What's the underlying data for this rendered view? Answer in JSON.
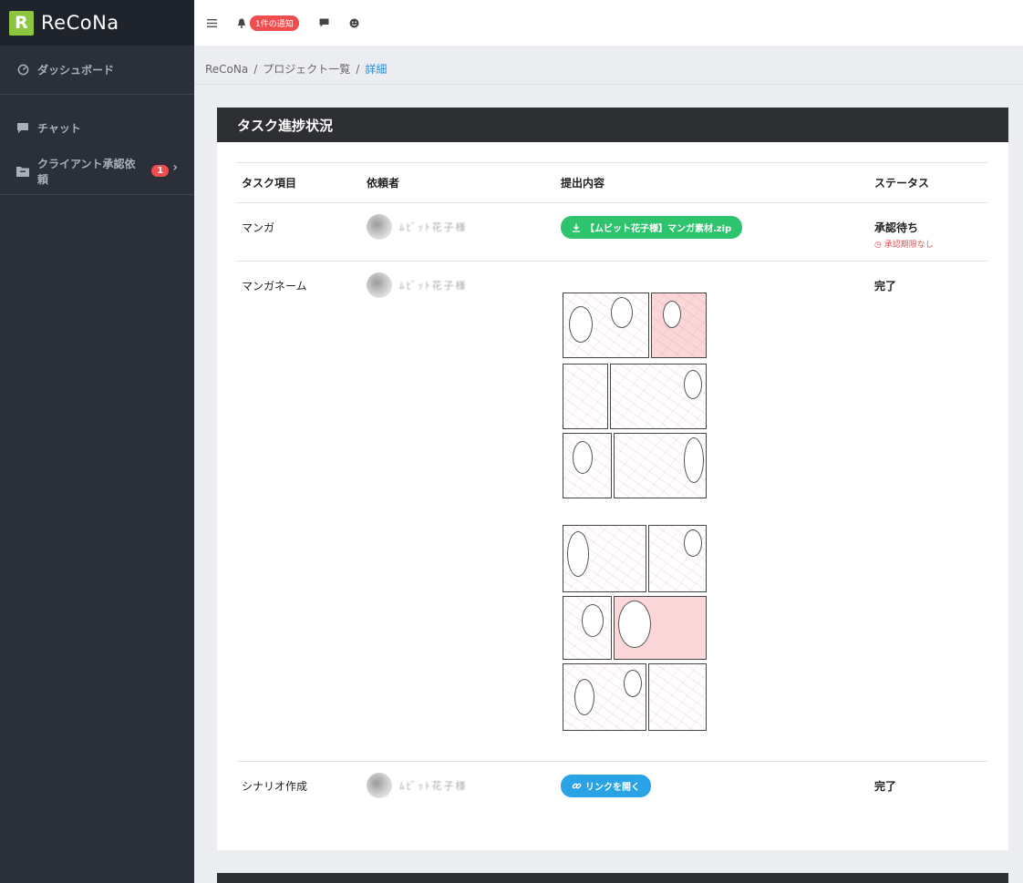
{
  "brand": {
    "mark": "R",
    "name": "ReCoNa"
  },
  "sidebar": {
    "items": [
      {
        "label": "ダッシュボード"
      },
      {
        "label": "チャット"
      },
      {
        "label": "クライアント承認依頼",
        "badge": "1"
      }
    ]
  },
  "topbar": {
    "notification_label": "1件の通知"
  },
  "breadcrumb": {
    "root": "ReCoNa",
    "middle": "プロジェクト一覧",
    "current": "詳細"
  },
  "card": {
    "title": "タスク進捗状況",
    "columns": [
      "タスク項目",
      "依頼者",
      "提出内容",
      "ステータス"
    ],
    "rows": [
      {
        "task": "マンガ",
        "requester": "ﾑﾋﾞｯﾄ花子様",
        "submission": "【ムビット花子様】マンガ素材.zip",
        "status": "承認待ち",
        "status_note": "承認期限なし"
      },
      {
        "task": "マンガネーム",
        "requester": "ﾑﾋﾞｯﾄ花子様",
        "submission": "",
        "status": "完了"
      },
      {
        "task": "シナリオ作成",
        "requester": "ﾑﾋﾞｯﾄ花子様",
        "submission": "リンクを開く",
        "status": "完了"
      }
    ]
  },
  "colors": {
    "sidebar_bg": "#2b2f3a",
    "accent_green": "#2ec46d",
    "accent_blue": "#2aa3e6",
    "badge_red": "#f04e4e",
    "brand_green": "#8cc63f"
  },
  "icons": [
    "menu-icon",
    "bell-icon",
    "chat-icon",
    "smiley-icon",
    "dashboard-icon",
    "download-icon",
    "clock-icon",
    "link-icon",
    "folder-icon"
  ]
}
